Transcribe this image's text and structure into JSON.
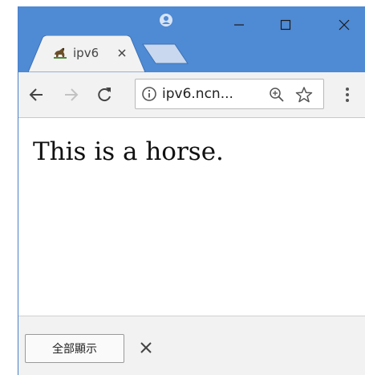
{
  "browser": {
    "tab": {
      "title": "ipv6",
      "favicon": "horse-favicon"
    },
    "address": {
      "url_display": "ipv6.ncn..."
    },
    "icons": {
      "profile": "profile-icon",
      "minimize": "minimize-icon",
      "maximize": "maximize-icon",
      "close": "close-icon",
      "back": "back-arrow-icon",
      "forward": "forward-arrow-icon",
      "reload": "reload-icon",
      "info": "info-icon",
      "zoom": "zoom-in-icon",
      "bookmark": "star-icon",
      "menu": "kebab-menu-icon"
    }
  },
  "page": {
    "text": "This is a horse."
  },
  "download_bar": {
    "show_all_label": "全部顯示"
  },
  "colors": {
    "titlebar": "#4f8ad4",
    "toolbar": "#f2f2f2",
    "page_background": "#ffffff"
  }
}
